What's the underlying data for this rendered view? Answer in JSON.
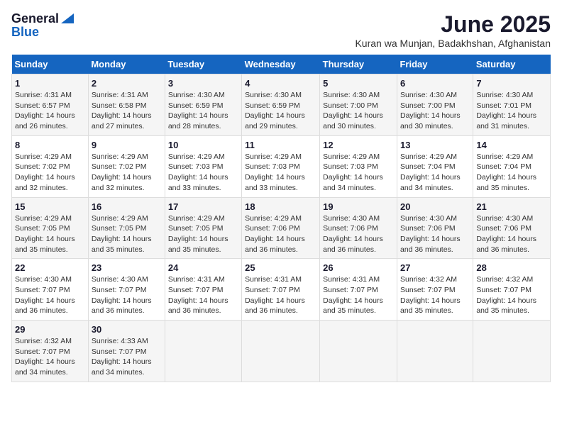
{
  "logo": {
    "general": "General",
    "blue": "Blue"
  },
  "title": {
    "month": "June 2025",
    "location": "Kuran wa Munjan, Badakhshan, Afghanistan"
  },
  "weekdays": [
    "Sunday",
    "Monday",
    "Tuesday",
    "Wednesday",
    "Thursday",
    "Friday",
    "Saturday"
  ],
  "weeks": [
    [
      {
        "day": "1",
        "sunrise": "4:31 AM",
        "sunset": "6:57 PM",
        "daylight": "14 hours and 26 minutes."
      },
      {
        "day": "2",
        "sunrise": "4:31 AM",
        "sunset": "6:58 PM",
        "daylight": "14 hours and 27 minutes."
      },
      {
        "day": "3",
        "sunrise": "4:30 AM",
        "sunset": "6:59 PM",
        "daylight": "14 hours and 28 minutes."
      },
      {
        "day": "4",
        "sunrise": "4:30 AM",
        "sunset": "6:59 PM",
        "daylight": "14 hours and 29 minutes."
      },
      {
        "day": "5",
        "sunrise": "4:30 AM",
        "sunset": "7:00 PM",
        "daylight": "14 hours and 30 minutes."
      },
      {
        "day": "6",
        "sunrise": "4:30 AM",
        "sunset": "7:00 PM",
        "daylight": "14 hours and 30 minutes."
      },
      {
        "day": "7",
        "sunrise": "4:30 AM",
        "sunset": "7:01 PM",
        "daylight": "14 hours and 31 minutes."
      }
    ],
    [
      {
        "day": "8",
        "sunrise": "4:29 AM",
        "sunset": "7:02 PM",
        "daylight": "14 hours and 32 minutes."
      },
      {
        "day": "9",
        "sunrise": "4:29 AM",
        "sunset": "7:02 PM",
        "daylight": "14 hours and 32 minutes."
      },
      {
        "day": "10",
        "sunrise": "4:29 AM",
        "sunset": "7:03 PM",
        "daylight": "14 hours and 33 minutes."
      },
      {
        "day": "11",
        "sunrise": "4:29 AM",
        "sunset": "7:03 PM",
        "daylight": "14 hours and 33 minutes."
      },
      {
        "day": "12",
        "sunrise": "4:29 AM",
        "sunset": "7:03 PM",
        "daylight": "14 hours and 34 minutes."
      },
      {
        "day": "13",
        "sunrise": "4:29 AM",
        "sunset": "7:04 PM",
        "daylight": "14 hours and 34 minutes."
      },
      {
        "day": "14",
        "sunrise": "4:29 AM",
        "sunset": "7:04 PM",
        "daylight": "14 hours and 35 minutes."
      }
    ],
    [
      {
        "day": "15",
        "sunrise": "4:29 AM",
        "sunset": "7:05 PM",
        "daylight": "14 hours and 35 minutes."
      },
      {
        "day": "16",
        "sunrise": "4:29 AM",
        "sunset": "7:05 PM",
        "daylight": "14 hours and 35 minutes."
      },
      {
        "day": "17",
        "sunrise": "4:29 AM",
        "sunset": "7:05 PM",
        "daylight": "14 hours and 35 minutes."
      },
      {
        "day": "18",
        "sunrise": "4:29 AM",
        "sunset": "7:06 PM",
        "daylight": "14 hours and 36 minutes."
      },
      {
        "day": "19",
        "sunrise": "4:30 AM",
        "sunset": "7:06 PM",
        "daylight": "14 hours and 36 minutes."
      },
      {
        "day": "20",
        "sunrise": "4:30 AM",
        "sunset": "7:06 PM",
        "daylight": "14 hours and 36 minutes."
      },
      {
        "day": "21",
        "sunrise": "4:30 AM",
        "sunset": "7:06 PM",
        "daylight": "14 hours and 36 minutes."
      }
    ],
    [
      {
        "day": "22",
        "sunrise": "4:30 AM",
        "sunset": "7:07 PM",
        "daylight": "14 hours and 36 minutes."
      },
      {
        "day": "23",
        "sunrise": "4:30 AM",
        "sunset": "7:07 PM",
        "daylight": "14 hours and 36 minutes."
      },
      {
        "day": "24",
        "sunrise": "4:31 AM",
        "sunset": "7:07 PM",
        "daylight": "14 hours and 36 minutes."
      },
      {
        "day": "25",
        "sunrise": "4:31 AM",
        "sunset": "7:07 PM",
        "daylight": "14 hours and 36 minutes."
      },
      {
        "day": "26",
        "sunrise": "4:31 AM",
        "sunset": "7:07 PM",
        "daylight": "14 hours and 35 minutes."
      },
      {
        "day": "27",
        "sunrise": "4:32 AM",
        "sunset": "7:07 PM",
        "daylight": "14 hours and 35 minutes."
      },
      {
        "day": "28",
        "sunrise": "4:32 AM",
        "sunset": "7:07 PM",
        "daylight": "14 hours and 35 minutes."
      }
    ],
    [
      {
        "day": "29",
        "sunrise": "4:32 AM",
        "sunset": "7:07 PM",
        "daylight": "14 hours and 34 minutes."
      },
      {
        "day": "30",
        "sunrise": "4:33 AM",
        "sunset": "7:07 PM",
        "daylight": "14 hours and 34 minutes."
      },
      null,
      null,
      null,
      null,
      null
    ]
  ]
}
